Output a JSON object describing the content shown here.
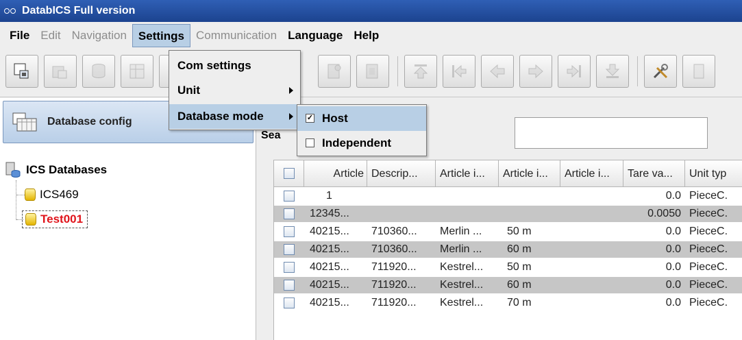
{
  "window": {
    "title": "DatabICS Full version"
  },
  "menubar": {
    "items": [
      {
        "label": "File",
        "state": "enabled"
      },
      {
        "label": "Edit",
        "state": "disabled"
      },
      {
        "label": "Navigation",
        "state": "disabled"
      },
      {
        "label": "Settings",
        "state": "active"
      },
      {
        "label": "Communication",
        "state": "disabled"
      },
      {
        "label": "Language",
        "state": "enabled"
      },
      {
        "label": "Help",
        "state": "enabled"
      }
    ]
  },
  "settings_menu": {
    "items": [
      {
        "label": "Com settings",
        "has_submenu": false
      },
      {
        "label": "Unit",
        "has_submenu": true
      },
      {
        "label": "Database mode",
        "has_submenu": true,
        "highlighted": true
      }
    ]
  },
  "database_mode_submenu": {
    "items": [
      {
        "label": "Host",
        "checked": true,
        "highlighted": true
      },
      {
        "label": "Independent",
        "checked": false,
        "highlighted": false
      }
    ]
  },
  "left_panel": {
    "database_config_button": "Database config",
    "tree": {
      "root": "ICS Databases",
      "children": [
        {
          "label": "ICS469",
          "selected": false
        },
        {
          "label": "Test001",
          "selected": true
        }
      ]
    }
  },
  "right_panel": {
    "search_label": "Sea",
    "search_value": ""
  },
  "table": {
    "columns": [
      "Article",
      "Descrip...",
      "Article i...",
      "Article i...",
      "Article i...",
      "Tare va...",
      "Unit typ"
    ],
    "rows": [
      [
        "1",
        "",
        "",
        "",
        "",
        "0.0",
        "PieceC."
      ],
      [
        "12345...",
        "",
        "",
        "",
        "",
        "0.0050",
        "PieceC."
      ],
      [
        "40215...",
        "710360...",
        "Merlin ...",
        "50 m",
        "",
        "0.0",
        "PieceC."
      ],
      [
        "40215...",
        "710360...",
        "Merlin ...",
        "60 m",
        "",
        "0.0",
        "PieceC."
      ],
      [
        "40215...",
        "711920...",
        "Kestrel...",
        "50 m",
        "",
        "0.0",
        "PieceC."
      ],
      [
        "40215...",
        "711920...",
        "Kestrel...",
        "60 m",
        "",
        "0.0",
        "PieceC."
      ],
      [
        "40215...",
        "711920...",
        "Kestrel...",
        "70 m",
        "",
        "0.0",
        "PieceC."
      ]
    ]
  },
  "colors": {
    "title_bar": "#1c438f",
    "selection": "#b8cfe5",
    "alt_row": "#c6c6c6",
    "selected_node_text": "#e0141b"
  }
}
